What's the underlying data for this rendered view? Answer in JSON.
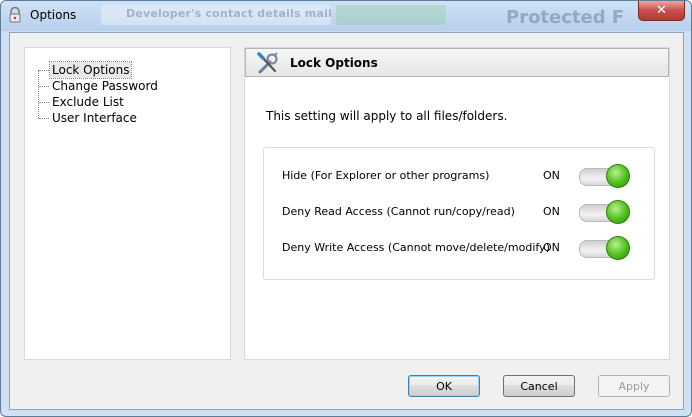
{
  "window": {
    "title": "Options",
    "close_label": "✕"
  },
  "background_window": {
    "text_1": "Developer's contact details mail",
    "text_2": "Protected F"
  },
  "tree": {
    "items": [
      {
        "label": "Lock Options",
        "selected": true
      },
      {
        "label": "Change Password",
        "selected": false
      },
      {
        "label": "Exclude List",
        "selected": false
      },
      {
        "label": "User Interface",
        "selected": false
      }
    ]
  },
  "panel": {
    "header_icon": "tools-icon",
    "title": "Lock Options",
    "description": "This setting will apply to all files/folders.",
    "options": [
      {
        "label": "Hide (For Explorer or other programs)",
        "state": "ON"
      },
      {
        "label": "Deny Read Access (Cannot run/copy/read)",
        "state": "ON"
      },
      {
        "label": "Deny Write Access (Cannot move/delete/modify)",
        "state": "ON"
      }
    ]
  },
  "buttons": {
    "ok": "OK",
    "cancel": "Cancel",
    "apply": "Apply"
  },
  "colors": {
    "toggle_on": "#4fbe1c",
    "close_button": "#c75050"
  }
}
